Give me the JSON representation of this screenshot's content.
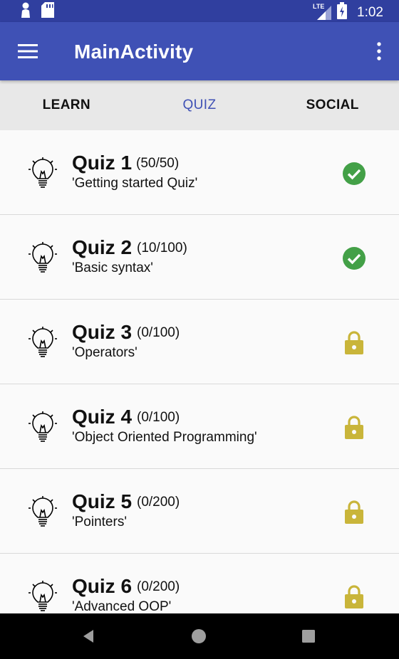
{
  "status_bar": {
    "time": "1:02",
    "network_label": "LTE",
    "icons": [
      "person-icon",
      "sd-card-icon",
      "lte-signal-icon",
      "battery-charging-icon"
    ]
  },
  "app_bar": {
    "title": "MainActivity",
    "menu_icon": "hamburger-menu-icon",
    "overflow_icon": "more-vert-icon",
    "color": "#3f51b5",
    "status_color": "#303f9f"
  },
  "tabs": [
    {
      "label": "LEARN",
      "active": false
    },
    {
      "label": "QUIZ",
      "active": true
    },
    {
      "label": "SOCIAL",
      "active": false
    }
  ],
  "quizzes": [
    {
      "title": "Quiz 1",
      "score": "(50/50)",
      "subtitle": "'Getting started Quiz'",
      "status": "completed"
    },
    {
      "title": "Quiz 2",
      "score": "(10/100)",
      "subtitle": "'Basic syntax'",
      "status": "completed"
    },
    {
      "title": "Quiz 3",
      "score": "(0/100)",
      "subtitle": "'Operators'",
      "status": "locked"
    },
    {
      "title": "Quiz 4",
      "score": "(0/100)",
      "subtitle": "'Object Oriented Programming'",
      "status": "locked"
    },
    {
      "title": "Quiz 5",
      "score": "(0/200)",
      "subtitle": "'Pointers'",
      "status": "locked"
    },
    {
      "title": "Quiz 6",
      "score": "(0/200)",
      "subtitle": "'Advanced OOP'",
      "status": "locked"
    }
  ],
  "colors": {
    "check": "#43a047",
    "lock": "#c9b53a"
  },
  "nav_bar": {
    "icons": [
      "back-icon",
      "home-icon",
      "recents-icon"
    ]
  }
}
